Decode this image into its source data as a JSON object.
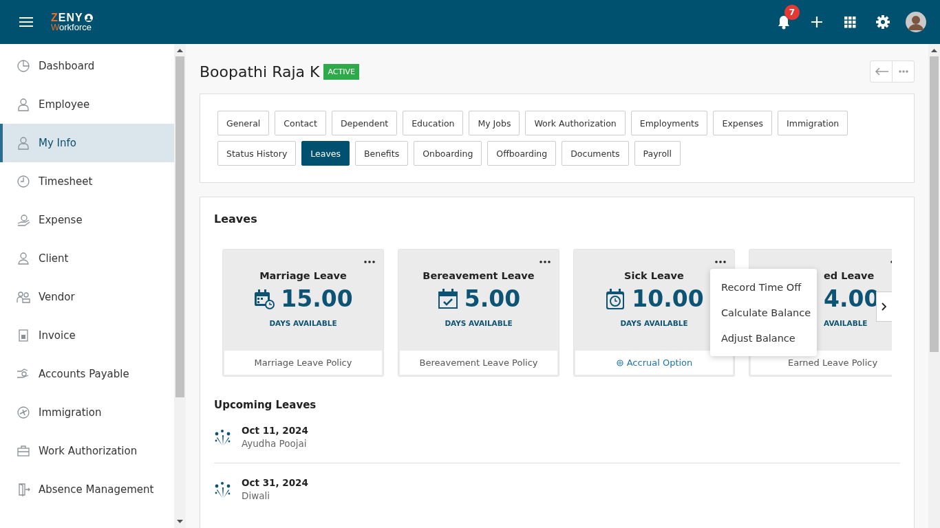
{
  "header": {
    "logo_top": "ZENY",
    "logo_bottom": "Workforce",
    "notification_count": "7"
  },
  "sidebar": {
    "items": [
      {
        "label": "Dashboard",
        "selected": false
      },
      {
        "label": "Employee",
        "selected": false
      },
      {
        "label": "My Info",
        "selected": true
      },
      {
        "label": "Timesheet",
        "selected": false
      },
      {
        "label": "Expense",
        "selected": false
      },
      {
        "label": "Client",
        "selected": false
      },
      {
        "label": "Vendor",
        "selected": false
      },
      {
        "label": "Invoice",
        "selected": false
      },
      {
        "label": "Accounts Payable",
        "selected": false
      },
      {
        "label": "Immigration",
        "selected": false
      },
      {
        "label": "Work Authorization",
        "selected": false
      },
      {
        "label": "Absence Management",
        "selected": false
      }
    ]
  },
  "profile": {
    "name": "Boopathi Raja K",
    "status": "ACTIVE"
  },
  "tabs": [
    {
      "label": "General",
      "selected": false
    },
    {
      "label": "Contact",
      "selected": false
    },
    {
      "label": "Dependent",
      "selected": false
    },
    {
      "label": "Education",
      "selected": false
    },
    {
      "label": "My Jobs",
      "selected": false
    },
    {
      "label": "Work Authorization",
      "selected": false
    },
    {
      "label": "Employments",
      "selected": false
    },
    {
      "label": "Expenses",
      "selected": false
    },
    {
      "label": "Immigration",
      "selected": false
    },
    {
      "label": "Status History",
      "selected": false
    },
    {
      "label": "Leaves",
      "selected": true
    },
    {
      "label": "Benefits",
      "selected": false
    },
    {
      "label": "Onboarding",
      "selected": false
    },
    {
      "label": "Offboarding",
      "selected": false
    },
    {
      "label": "Documents",
      "selected": false
    },
    {
      "label": "Payroll",
      "selected": false
    }
  ],
  "leaves": {
    "title": "Leaves",
    "cards": [
      {
        "kind": "full",
        "title": "Marriage Leave",
        "amount": "15.00",
        "caption": "DAYS AVAILABLE",
        "footer": {
          "kind": "text",
          "text": "Marriage Leave Policy"
        }
      },
      {
        "kind": "full",
        "title": "Bereavement Leave",
        "amount": "5.00",
        "caption": "DAYS AVAILABLE",
        "footer": {
          "kind": "text",
          "text": "Bereavement Leave Policy"
        }
      },
      {
        "kind": "full",
        "title": "Sick Leave",
        "amount": "10.00",
        "caption": "DAYS AVAILABLE",
        "footer": {
          "kind": "link",
          "text": "Accrual Option"
        }
      },
      {
        "kind": "partial",
        "title": "ed Leave",
        "amount": "4.00",
        "caption": "AVAILABLE",
        "footer": {
          "kind": "text",
          "text": "Earned Leave Policy"
        }
      }
    ],
    "menu": [
      "Record Time Off",
      "Calculate Balance",
      "Adjust Balance"
    ]
  },
  "upcoming": {
    "title": "Upcoming Leaves",
    "items": [
      {
        "date": "Oct 11, 2024",
        "name": "Ayudha Poojai"
      },
      {
        "date": "Oct 31, 2024",
        "name": "Diwali"
      }
    ]
  }
}
